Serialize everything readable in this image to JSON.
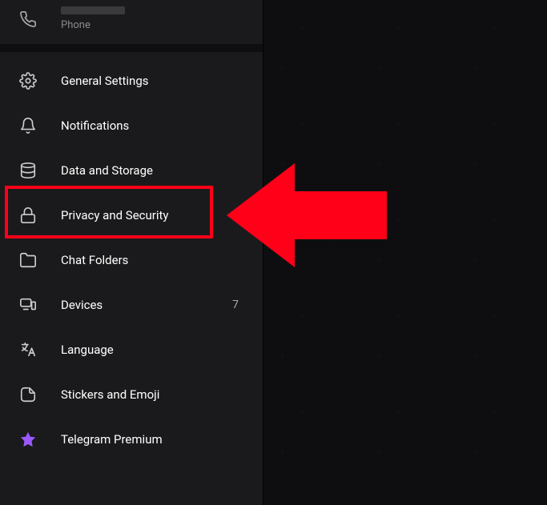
{
  "profile": {
    "label": "Phone"
  },
  "menu": {
    "general": "General Settings",
    "notifications": "Notifications",
    "data": "Data and Storage",
    "privacy": "Privacy and Security",
    "folders": "Chat Folders",
    "devices": "Devices",
    "devices_count": "7",
    "language": "Language",
    "stickers": "Stickers and Emoji",
    "premium": "Telegram Premium"
  },
  "annotation": {
    "highlight_target": "privacy",
    "highlight_color": "#ff0018"
  }
}
